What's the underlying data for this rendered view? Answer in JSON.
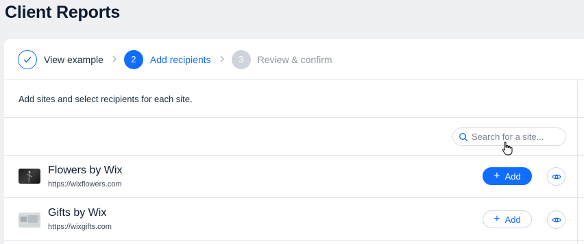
{
  "page": {
    "title": "Client Reports"
  },
  "stepper": {
    "steps": [
      {
        "number": "",
        "label": "View example",
        "state": "done"
      },
      {
        "number": "2",
        "label": "Add recipients",
        "state": "active"
      },
      {
        "number": "3",
        "label": "Review & confirm",
        "state": "future"
      }
    ]
  },
  "instructions": "Add sites and select recipients for each site.",
  "search": {
    "placeholder": "Search for a site..."
  },
  "sites": [
    {
      "name": "Flowers by Wix",
      "url": "https://wixflowers.com",
      "add_label": "Add",
      "add_style": "primary"
    },
    {
      "name": "Gifts by Wix",
      "url": "https://wixgifts.com",
      "add_label": "Add",
      "add_style": "secondary"
    }
  ],
  "colors": {
    "accent": "#116dff",
    "background": "#eef0f4",
    "divider": "#dfe5eb"
  },
  "icons": [
    "check-icon",
    "chevron-right-icon",
    "search-icon",
    "plus-icon",
    "eye-icon",
    "hand-cursor-icon"
  ]
}
